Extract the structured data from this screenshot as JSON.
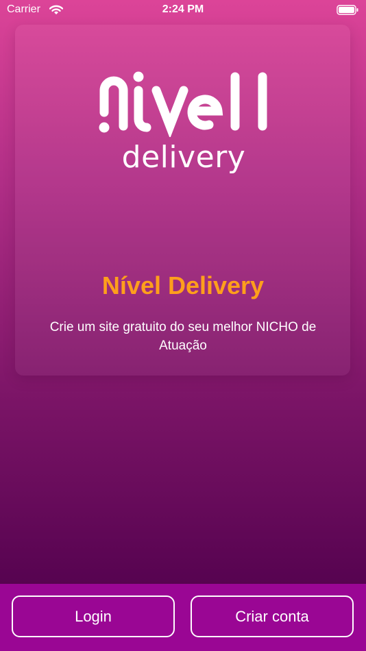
{
  "status_bar": {
    "carrier": "Carrier",
    "time": "2:24 PM",
    "icons": [
      "wifi-icon",
      "battery-icon"
    ]
  },
  "logo": {
    "wordmark": "nível",
    "subtext": "delivery"
  },
  "hero": {
    "title": "Nível Delivery",
    "subtitle": "Crie um site gratuito do seu melhor NICHO de Atuação"
  },
  "actions": {
    "login_label": "Login",
    "signup_label": "Criar conta"
  },
  "colors": {
    "gradient_top": "#dc4498",
    "gradient_bottom": "#520150",
    "title_accent": "#ff9f1c",
    "bottom_bar": "#9a0694",
    "text": "#ffffff"
  }
}
